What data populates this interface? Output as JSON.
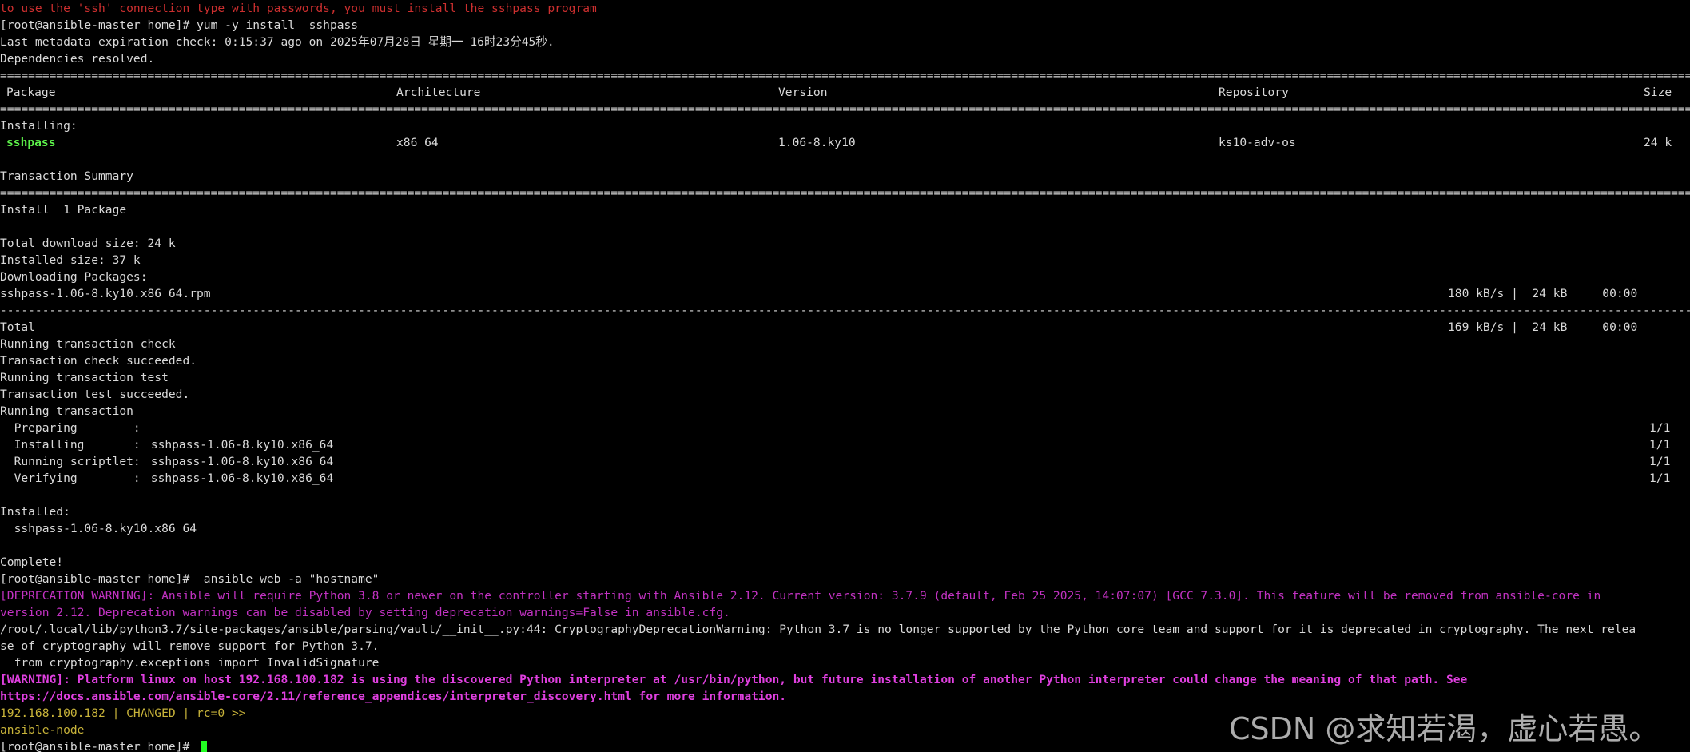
{
  "terminal": {
    "warning_sshpass": "to use the 'ssh' connection type with passwords, you must install the sshpass program",
    "prompt1": "[root@ansible-master home]# yum -y install  sshpass",
    "metadata": "Last metadata expiration check: 0:15:37 ago on 2025年07月28日 星期一 16时23分45秒.",
    "deps": "Dependencies resolved.",
    "separator_eq": "====================================================================================================================================================================================================================================================",
    "separator_dash": "--------------------------------------------------------------------------------------------------------------------------------------------------------------------------------------------------------------------------------------------------------------",
    "table": {
      "headers": {
        "package": "Package",
        "arch": "Architecture",
        "version": "Version",
        "repo": "Repository",
        "size": "Size"
      },
      "installing_label": "Installing:",
      "row": {
        "package": "sshpass",
        "arch": "x86_64",
        "version": "1.06-8.ky10",
        "repo": "ks10-adv-os",
        "size": "24 k"
      }
    },
    "transaction_summary": "Transaction Summary",
    "install_count": "Install  1 Package",
    "total_download": "Total download size: 24 k",
    "installed_size": "Installed size: 37 k",
    "downloading": "Downloading Packages:",
    "download_file": "sshpass-1.06-8.ky10.x86_64.rpm",
    "download_stats": "180 kB/s |  24 kB     00:00",
    "total_label": "Total",
    "total_stats": "169 kB/s |  24 kB     00:00",
    "run_check": "Running transaction check",
    "check_ok": "Transaction check succeeded.",
    "run_test": "Running transaction test",
    "test_ok": "Transaction test succeeded.",
    "run_tx": "Running transaction",
    "steps": [
      {
        "label": "  Preparing        :",
        "pkg": "",
        "progress": "1/1"
      },
      {
        "label": "  Installing       :",
        "pkg": " sshpass-1.06-8.ky10.x86_64",
        "progress": "1/1"
      },
      {
        "label": "  Running scriptlet:",
        "pkg": " sshpass-1.06-8.ky10.x86_64",
        "progress": "1/1"
      },
      {
        "label": "  Verifying        :",
        "pkg": " sshpass-1.06-8.ky10.x86_64",
        "progress": "1/1"
      }
    ],
    "installed_label": "Installed:",
    "installed_pkg": "  sshpass-1.06-8.ky10.x86_64",
    "complete": "Complete!",
    "prompt2": "[root@ansible-master home]#  ansible web -a \"hostname\"",
    "deprecation_1": "[DEPRECATION WARNING]: Ansible will require Python 3.8 or newer on the controller starting with Ansible 2.12. Current version: 3.7.9 (default, Feb 25 2025, 14:07:07) [GCC 7.3.0]. This feature will be removed from ansible-core in",
    "deprecation_2": "version 2.12. Deprecation warnings can be disabled by setting deprecation_warnings=False in ansible.cfg.",
    "crypto_1": "/root/.local/lib/python3.7/site-packages/ansible/parsing/vault/__init__.py:44: CryptographyDeprecationWarning: Python 3.7 is no longer supported by the Python core team and support for it is deprecated in cryptography. The next relea",
    "crypto_2": "se of cryptography will remove support for Python 3.7.",
    "crypto_3": "  from cryptography.exceptions import InvalidSignature",
    "warning_1": "[WARNING]: Platform linux on host 192.168.100.182 is using the discovered Python interpreter at /usr/bin/python, but future installation of another Python interpreter could change the meaning of that path. See",
    "warning_2": "https://docs.ansible.com/ansible-core/2.11/reference_appendices/interpreter_discovery.html for more information.",
    "result_header": "192.168.100.182 | CHANGED | rc=0 >>",
    "result_body": "ansible-node",
    "prompt3": "[root@ansible-master home]# "
  },
  "watermark": "CSDN @求知若渴，虚心若愚。",
  "colors": {
    "background": "#000000",
    "text": "#d9d9d9",
    "error_red": "#cc2f2f",
    "package_green": "#5cf04a",
    "deprecation_magenta": "#c232c2",
    "warning_magenta": "#e040e0",
    "result_yellow": "#c9b43a",
    "cursor_green": "#22ff22"
  }
}
